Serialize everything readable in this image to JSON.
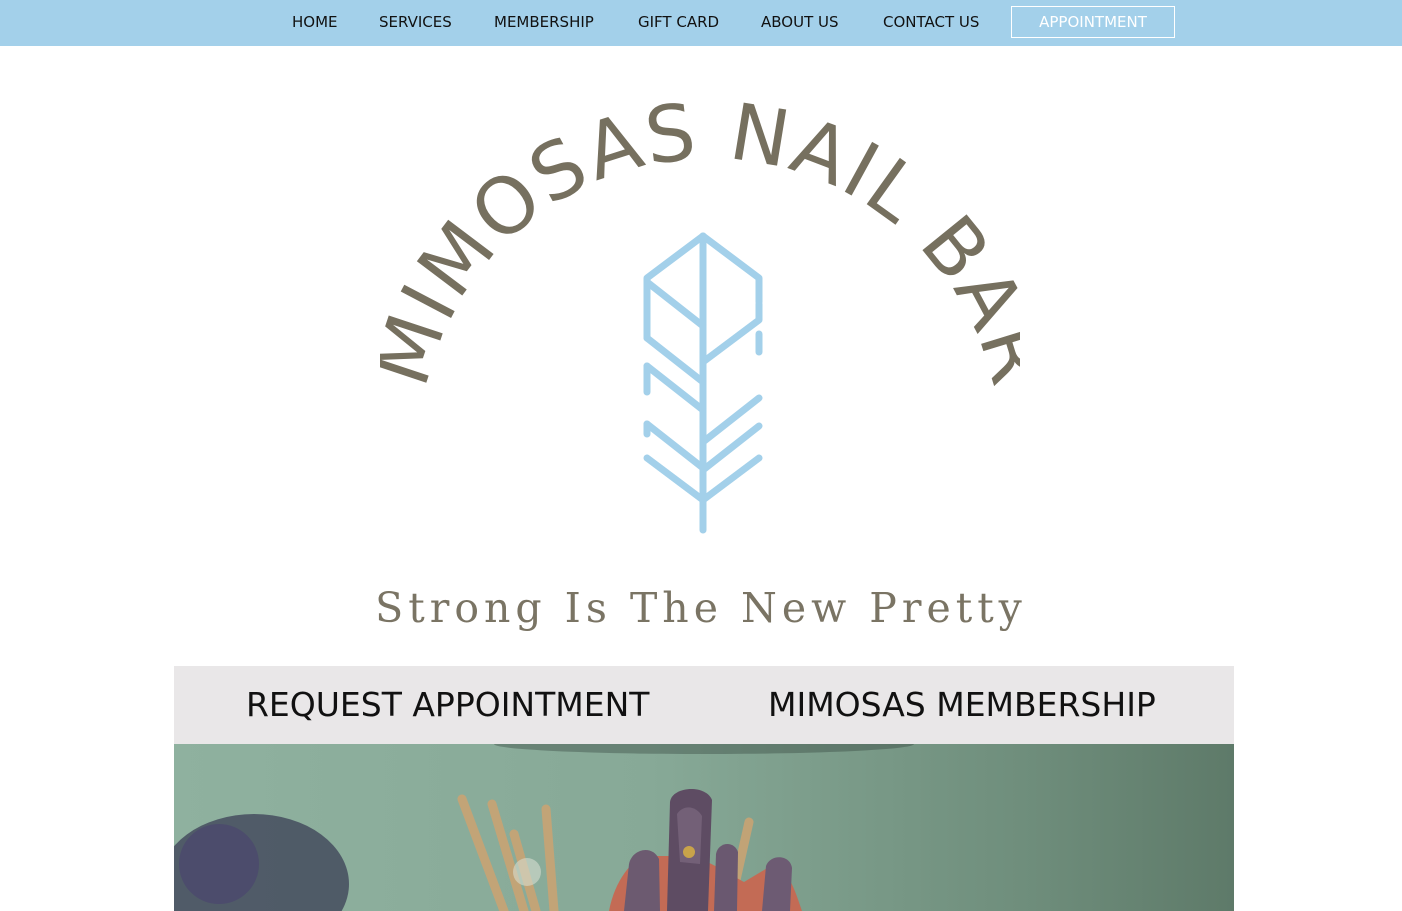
{
  "nav": {
    "items": [
      {
        "label": "HOME"
      },
      {
        "label": "SERVICES"
      },
      {
        "label": "MEMBERSHIP"
      },
      {
        "label": "GIFT CARD"
      },
      {
        "label": "ABOUT US"
      },
      {
        "label": "CONTACT US"
      }
    ],
    "appointment_label": "APPOINTMENT"
  },
  "logo": {
    "brand_text": "MIMOSAS NAIL BAR",
    "icon": "feather-icon"
  },
  "tagline": "Strong Is The New Pretty",
  "cta": {
    "request_label": "REQUEST APPOINTMENT",
    "membership_label": "MIMOSAS MEMBERSHIP"
  },
  "hero": {
    "image": "nail-art-hand-photo"
  },
  "colors": {
    "nav_bg": "#a3d0ea",
    "logo_text": "#76705f",
    "feather": "#a3d0ea",
    "cta_band": "#e9e7e8"
  }
}
